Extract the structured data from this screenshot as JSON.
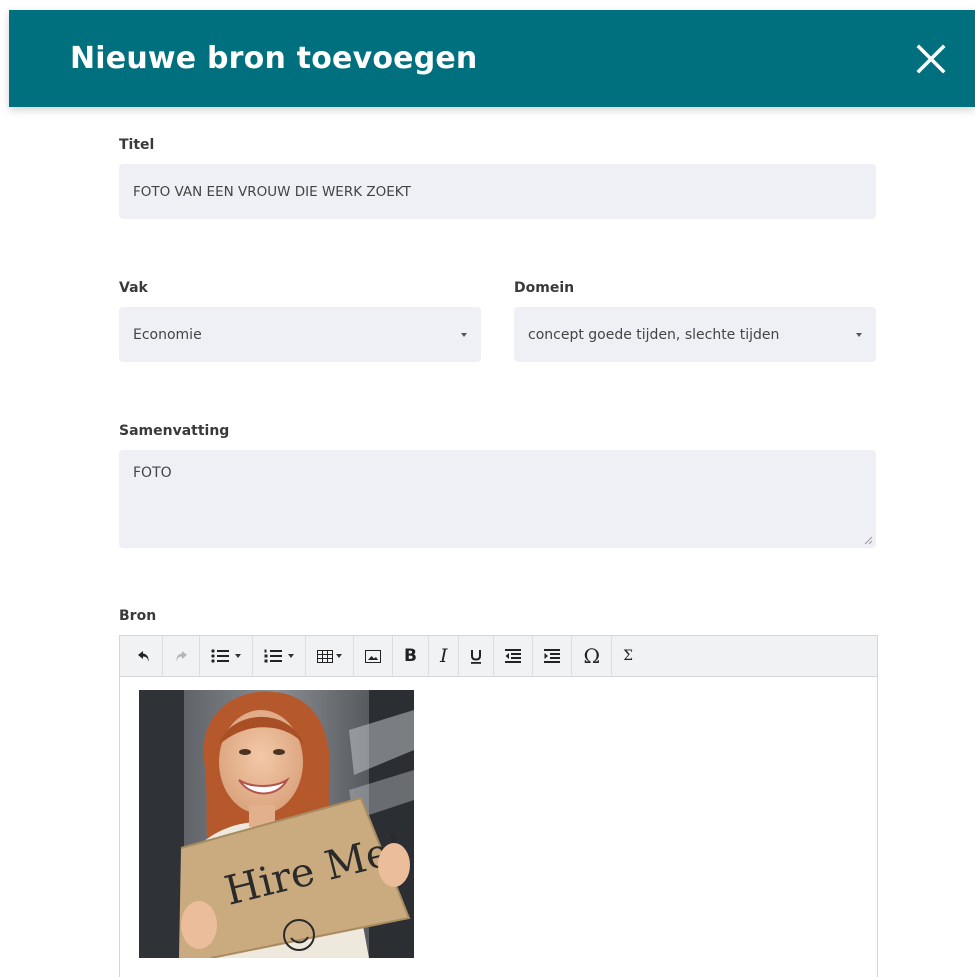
{
  "modal": {
    "title": "Nieuwe bron toevoegen",
    "close_icon": "close-icon"
  },
  "form": {
    "titel": {
      "label": "Titel",
      "value": "FOTO VAN EEN VROUW DIE WERK ZOEKT"
    },
    "vak": {
      "label": "Vak",
      "selected": "Economie"
    },
    "domein": {
      "label": "Domein",
      "selected": "concept goede tijden, slechte tijden"
    },
    "samenvatting": {
      "label": "Samenvatting",
      "value": "FOTO"
    },
    "bron": {
      "label": "Bron"
    }
  },
  "editor": {
    "toolbar": [
      "undo-icon",
      "redo-icon",
      "bulleted-list-icon",
      "numbered-list-icon",
      "table-icon",
      "image-icon",
      "bold-icon",
      "italic-icon",
      "underline-icon",
      "outdent-icon",
      "indent-icon",
      "special-character-icon",
      "formula-icon"
    ],
    "image_sign_text": "Hire Me!"
  },
  "colors": {
    "header": "#00707e",
    "field_bg": "#eef0f5"
  }
}
